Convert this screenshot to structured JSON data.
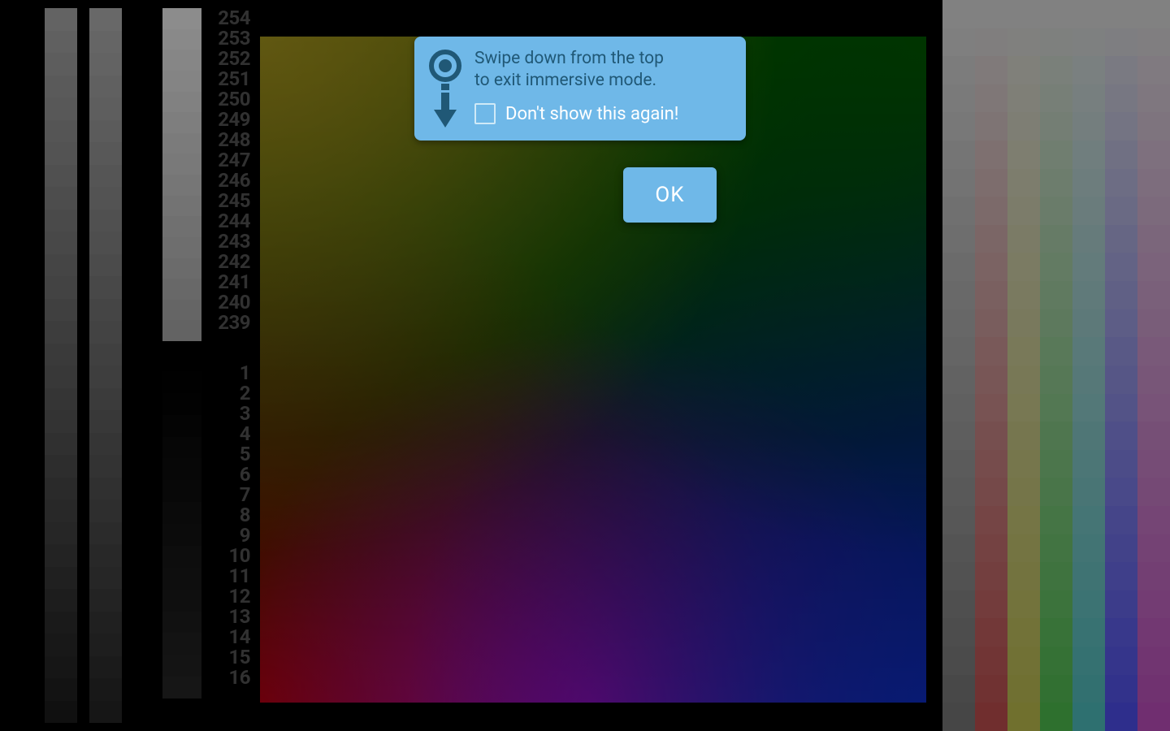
{
  "ruler": {
    "high": [
      "254",
      "253",
      "252",
      "251",
      "250",
      "249",
      "248",
      "247",
      "246",
      "245",
      "244",
      "243",
      "242",
      "241",
      "240",
      "239"
    ],
    "low": [
      "1",
      "2",
      "3",
      "4",
      "5",
      "6",
      "7",
      "8",
      "9",
      "10",
      "11",
      "12",
      "13",
      "14",
      "15",
      "16"
    ]
  },
  "grayscale": {
    "col1_steps": 32,
    "col2_steps": 32,
    "col3_high_start": 255,
    "col3_high_end": 180,
    "col3_low_start": 0,
    "col3_low_end": 40
  },
  "swatches": {
    "hues": [
      "#808080",
      "#cc5555",
      "#cccc55",
      "#55cc55",
      "#55cccc",
      "#5555ff",
      "#cc55cc"
    ],
    "steps": 26
  },
  "dialog": {
    "message_line1": "Swipe down from the top",
    "message_line2": "to exit immersive mode.",
    "checkbox_label": "Don't show this again!",
    "ok_label": "OK",
    "bubble_color": "#6fb8e8",
    "text_color": "#205876"
  }
}
